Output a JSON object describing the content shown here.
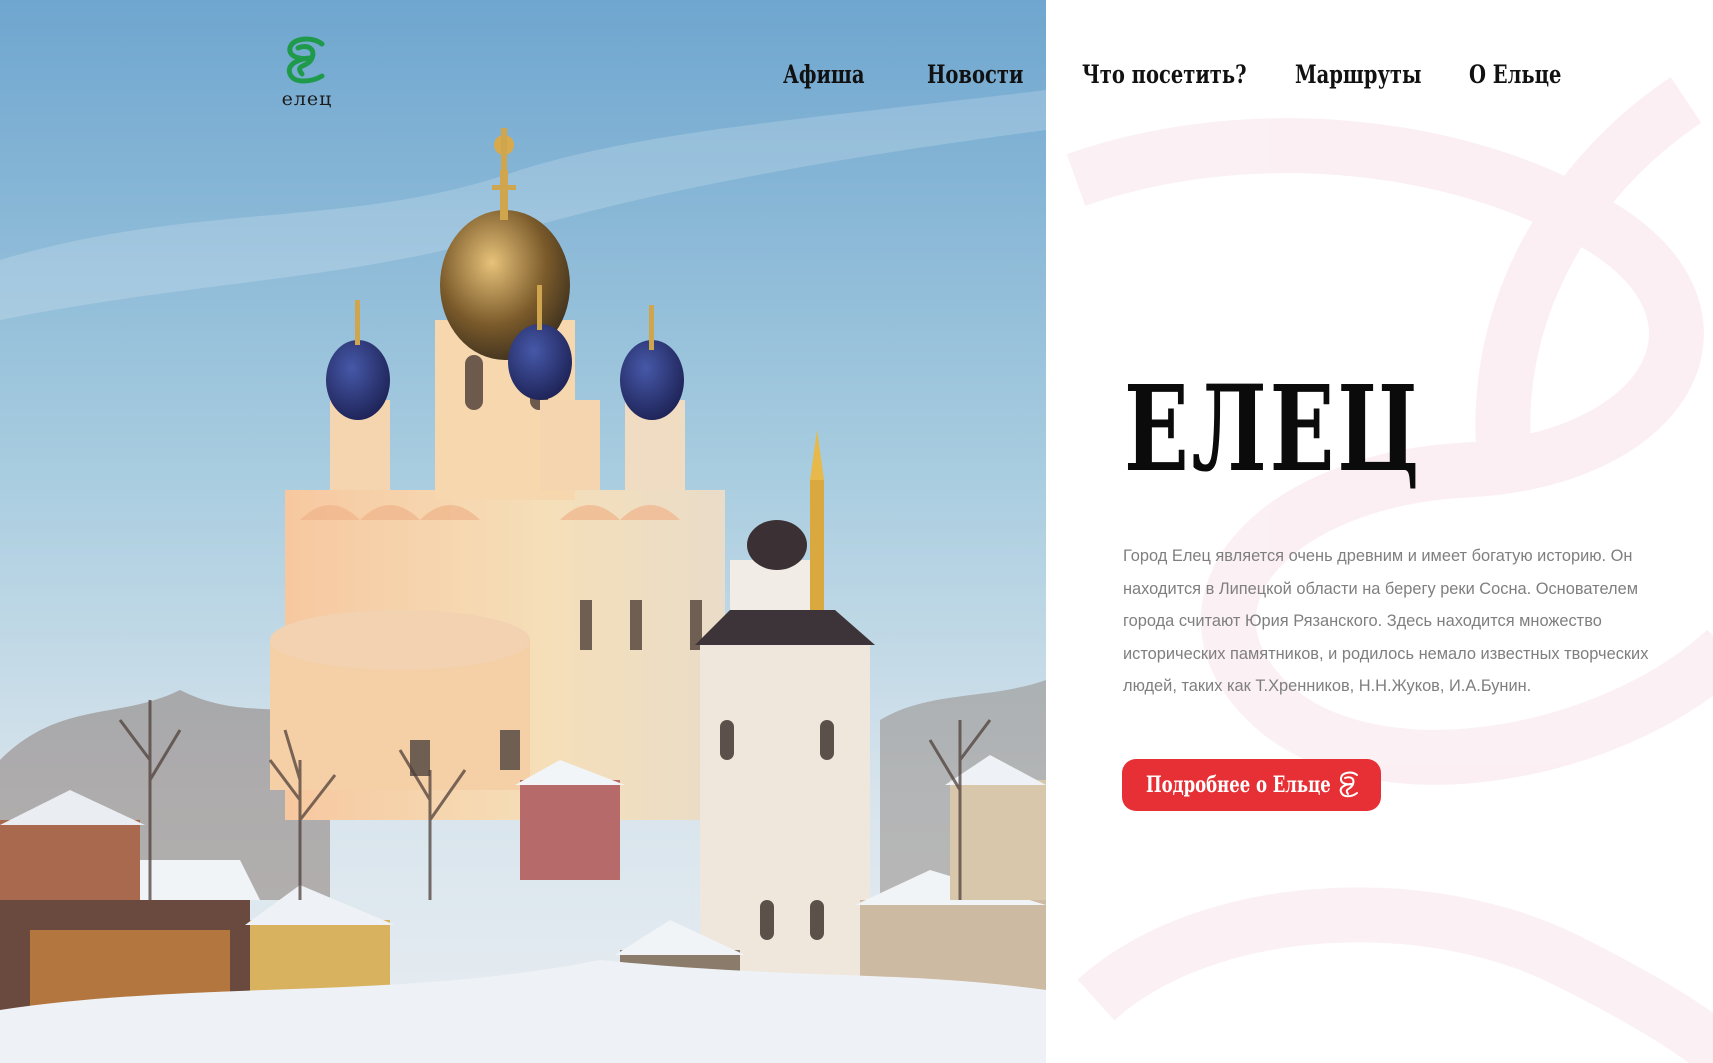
{
  "logo": {
    "text": "елец"
  },
  "nav": {
    "items": [
      {
        "label": "Афиша"
      },
      {
        "label": "Новости"
      },
      {
        "label": "Что посетить?"
      },
      {
        "label": "Маршруты"
      },
      {
        "label": "О Ельце"
      }
    ]
  },
  "hero": {
    "title": "ЕЛЕЦ",
    "description": "Город Елец является очень древним и имеет богатую историю. Он находится в Липецкой области на берегу реки Сосна. Основателем города считают Юрия Рязанского. Здесь находится множество исторических памятников, и родилось немало известных творческих людей, таких как Т.Хренников, Н.Н.Жуков, И.А.Бунин.",
    "button_label": "Подробнее о Ельце"
  },
  "colors": {
    "accent_red": "#e73035",
    "logo_green": "#1f9a4a",
    "text_gray": "#7f7f7f"
  },
  "icons": [
    "logo-emblem-icon",
    "emblem-icon"
  ]
}
